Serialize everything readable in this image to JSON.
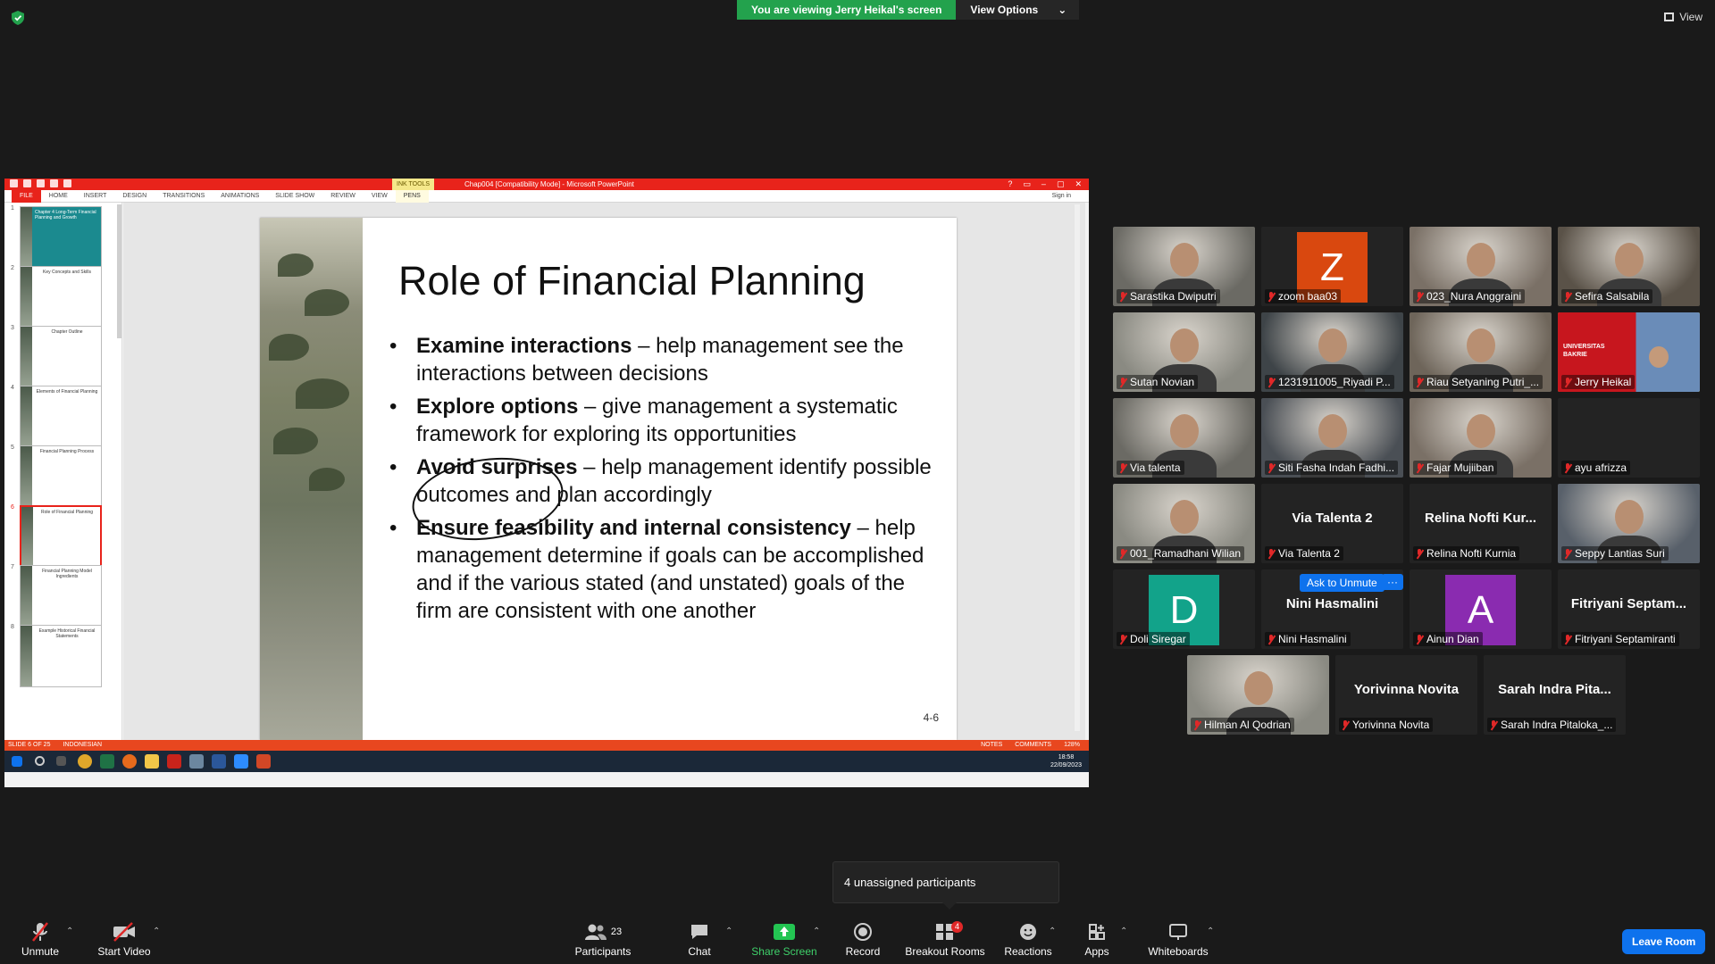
{
  "banner": {
    "viewing": "You are viewing Jerry Heikal's screen",
    "view_options": "View Options"
  },
  "view_label": "View",
  "ppt": {
    "doc_title": "Chap004 [Compatibility Mode] - Microsoft PowerPoint",
    "ink_tools": "INK TOOLS",
    "window_controls": [
      "?",
      "▭",
      "–",
      "▢",
      "✕"
    ],
    "sign_in": "Sign in",
    "tabs": [
      "FILE",
      "HOME",
      "INSERT",
      "DESIGN",
      "TRANSITIONS",
      "ANIMATIONS",
      "SLIDE SHOW",
      "REVIEW",
      "VIEW",
      "PENS"
    ],
    "thumbnails": [
      {
        "num": "1",
        "title": "Chapter 4 Long-Term Financial Planning and Growth"
      },
      {
        "num": "2",
        "title": "Key Concepts and Skills"
      },
      {
        "num": "3",
        "title": "Chapter Outline"
      },
      {
        "num": "4",
        "title": "Elements of Financial Planning"
      },
      {
        "num": "5",
        "title": "Financial Planning Process"
      },
      {
        "num": "6",
        "title": "Role of Financial Planning"
      },
      {
        "num": "7",
        "title": "Financial Planning Model Ingredients"
      },
      {
        "num": "8",
        "title": "Example Historical Financial Statements"
      }
    ],
    "slide": {
      "title": "Role of Financial Planning",
      "bullets": [
        {
          "bold": "Examine interactions",
          "rest": " – help management see the interactions between decisions"
        },
        {
          "bold": "Explore options",
          "rest": " – give management a systematic framework for exploring its opportunities"
        },
        {
          "bold": "Avoid surprises",
          "rest": " – help management identify possible outcomes and plan accordingly"
        },
        {
          "bold": "Ensure feasibility and internal consistency",
          "rest": " – help management determine if goals can be accomplished and if the various stated (and unstated) goals of the firm are consistent with one another"
        }
      ],
      "number": "4-6"
    },
    "status": {
      "slide": "SLIDE 6 OF 25",
      "language": "INDONESIAN",
      "notes": "NOTES",
      "comments": "COMMENTS",
      "zoom": "128%"
    },
    "clock": {
      "time": "18:58",
      "date": "22/09/2023"
    }
  },
  "participants": [
    {
      "name": "Sarastika Dwiputri",
      "type": "video"
    },
    {
      "name": "zoom baa03",
      "type": "avatar",
      "letter": "Z",
      "color": "#d9480f"
    },
    {
      "name": "023_Nura Anggraini",
      "type": "video"
    },
    {
      "name": "Sefira Salsabila",
      "type": "video"
    },
    {
      "name": "Sutan Novian",
      "type": "video"
    },
    {
      "name": "1231911005_Riyadi P...",
      "type": "video"
    },
    {
      "name": "Riau Setyaning Putri_...",
      "type": "video"
    },
    {
      "name": "Jerry Heikal",
      "type": "video",
      "active": true
    },
    {
      "name": "Via talenta",
      "type": "video"
    },
    {
      "name": "Siti Fasha Indah Fadhi...",
      "type": "video"
    },
    {
      "name": "Fajar Mujiiban",
      "type": "video"
    },
    {
      "name": "ayu afrizza",
      "type": "blank"
    },
    {
      "name": "001_Ramadhani Wilian",
      "type": "video"
    },
    {
      "name": "Via Talenta 2",
      "type": "text",
      "big": "Via Talenta 2"
    },
    {
      "name": "Relina Nofti Kurnia",
      "type": "text",
      "big": "Relina Nofti Kur..."
    },
    {
      "name": "Seppy Lantias Suri",
      "type": "video"
    },
    {
      "name": "Doli Siregar",
      "type": "avatar",
      "letter": "D",
      "color": "#12a38a"
    },
    {
      "name": "Nini Hasmalini",
      "type": "text",
      "big": "Nini Hasmalini"
    },
    {
      "name": "Ainun Dian",
      "type": "avatar",
      "letter": "A",
      "color": "#8a2bb0"
    },
    {
      "name": "Fitriyani Septamiranti",
      "type": "text",
      "big": "Fitriyani Septam..."
    },
    {
      "name": "Hilman Al Qodrian",
      "type": "video"
    },
    {
      "name": "Yorivinna Novita",
      "type": "text",
      "big": "Yorivinna Novita"
    },
    {
      "name": "Sarah Indra Pitaloka_...",
      "type": "text",
      "big": "Sarah Indra Pita..."
    }
  ],
  "jerry_tile_text": {
    "line1": "UNIVERSITAS",
    "line2": "BAKRIE"
  },
  "ask_unmute": "Ask to Unmute",
  "ask_more": "···",
  "tooltip": "4 unassigned participants",
  "toolbar": {
    "unmute": "Unmute",
    "start_video": "Start Video",
    "participants": "Participants",
    "participants_count": "23",
    "chat": "Chat",
    "share_screen": "Share Screen",
    "record": "Record",
    "breakout_rooms": "Breakout Rooms",
    "breakout_badge": "4",
    "reactions": "Reactions",
    "apps": "Apps",
    "whiteboards": "Whiteboards",
    "leave": "Leave Room"
  },
  "colors": {
    "zoom_blue": "#0e72ed",
    "share_green": "#23a24d",
    "ppt_red": "#e8231b",
    "active_yellow": "#e9e73b"
  }
}
